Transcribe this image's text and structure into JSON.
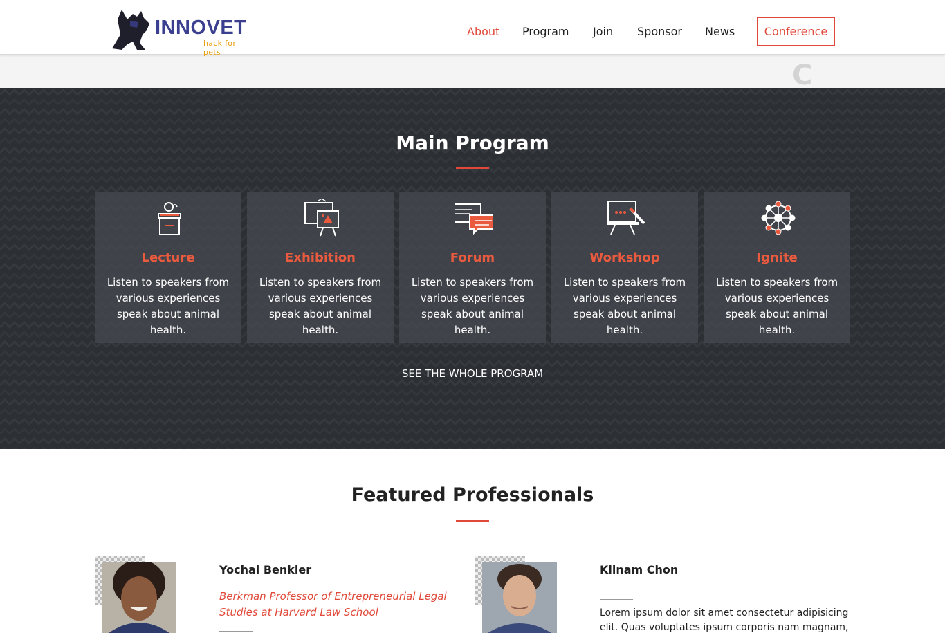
{
  "brand": {
    "name": "INNOVET",
    "tagline": "hack for pets",
    "colors": {
      "navy": "#3b3f8f",
      "accent": "#e0493a",
      "orange": "#e8a10f",
      "dark_bg": "#2c2f33"
    }
  },
  "nav": {
    "items": [
      {
        "label": "About",
        "active": true
      },
      {
        "label": "Program",
        "active": false
      },
      {
        "label": "Join",
        "active": false
      },
      {
        "label": "Sponsor",
        "active": false
      },
      {
        "label": "News",
        "active": false
      }
    ],
    "cta": "Conference"
  },
  "strip": {
    "glyph": "C"
  },
  "program": {
    "title": "Main Program",
    "cards": [
      {
        "icon": "lectern-icon",
        "title": "Lecture",
        "description": "Listen to speakers from various experiences speak about animal health."
      },
      {
        "icon": "exhibition-board-icon",
        "title": "Exhibition",
        "description": "Listen to speakers from various experiences speak about animal health."
      },
      {
        "icon": "chat-bubbles-icon",
        "title": "Forum",
        "description": "Listen to speakers from various experiences speak about animal health."
      },
      {
        "icon": "whiteboard-pen-icon",
        "title": "Workshop",
        "description": "Listen to speakers from various experiences speak about animal health."
      },
      {
        "icon": "network-icon",
        "title": "Ignite",
        "description": "Listen to speakers from various experiences speak about animal health."
      }
    ],
    "link_label": "SEE THE WHOLE PROGRAM"
  },
  "professionals": {
    "title": "Featured Professionals",
    "people": [
      {
        "name": "Yochai Benkler",
        "role": "Berkman Professor of Entrepreneurial Legal Studies at Harvard Law School",
        "bio": ""
      },
      {
        "name": "Kilnam Chon",
        "role": "",
        "bio": "Lorem ipsum dolor sit amet consectetur adipisicing elit. Quas voluptates ipsum corporis nam magnam,"
      }
    ]
  }
}
